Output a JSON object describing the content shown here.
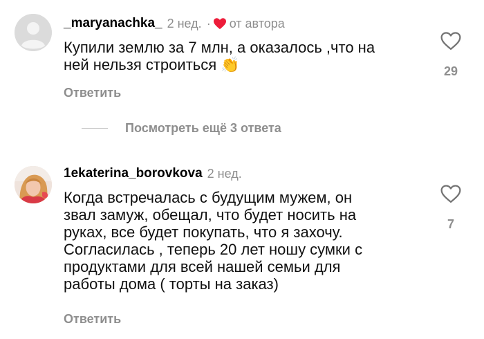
{
  "comments": [
    {
      "username": "_maryanachka_",
      "time": "2 нед.",
      "separator": "·",
      "author_like_label": "от автора",
      "text_lines": [
        "Купили землю за 7 млн, а оказалось ,что на",
        "ней нельзя строиться"
      ],
      "emoji": "👏",
      "reply_label": "Ответить",
      "likes": "29",
      "view_replies_label": "Посмотреть ещё 3 ответа"
    },
    {
      "username": "1ekaterina_borovkova",
      "time": "2 нед.",
      "text_lines": [
        "Когда встречалась с будущим мужем, он",
        "звал замуж, обещал, что будет носить на",
        "руках, все будет покупать, что я захочу.",
        "Согласилась , теперь 20 лет ношу сумки с",
        "продуктами для всей нашей семьи для",
        "работы дома ( торты на заказ)"
      ],
      "reply_label": "Ответить",
      "likes": "7"
    }
  ],
  "colors": {
    "secondary_text": "#8e8e8e",
    "author_heart": "#ed1c3a"
  },
  "icons": {
    "like": "heart-outline-icon",
    "author_like": "heart-filled-icon"
  }
}
